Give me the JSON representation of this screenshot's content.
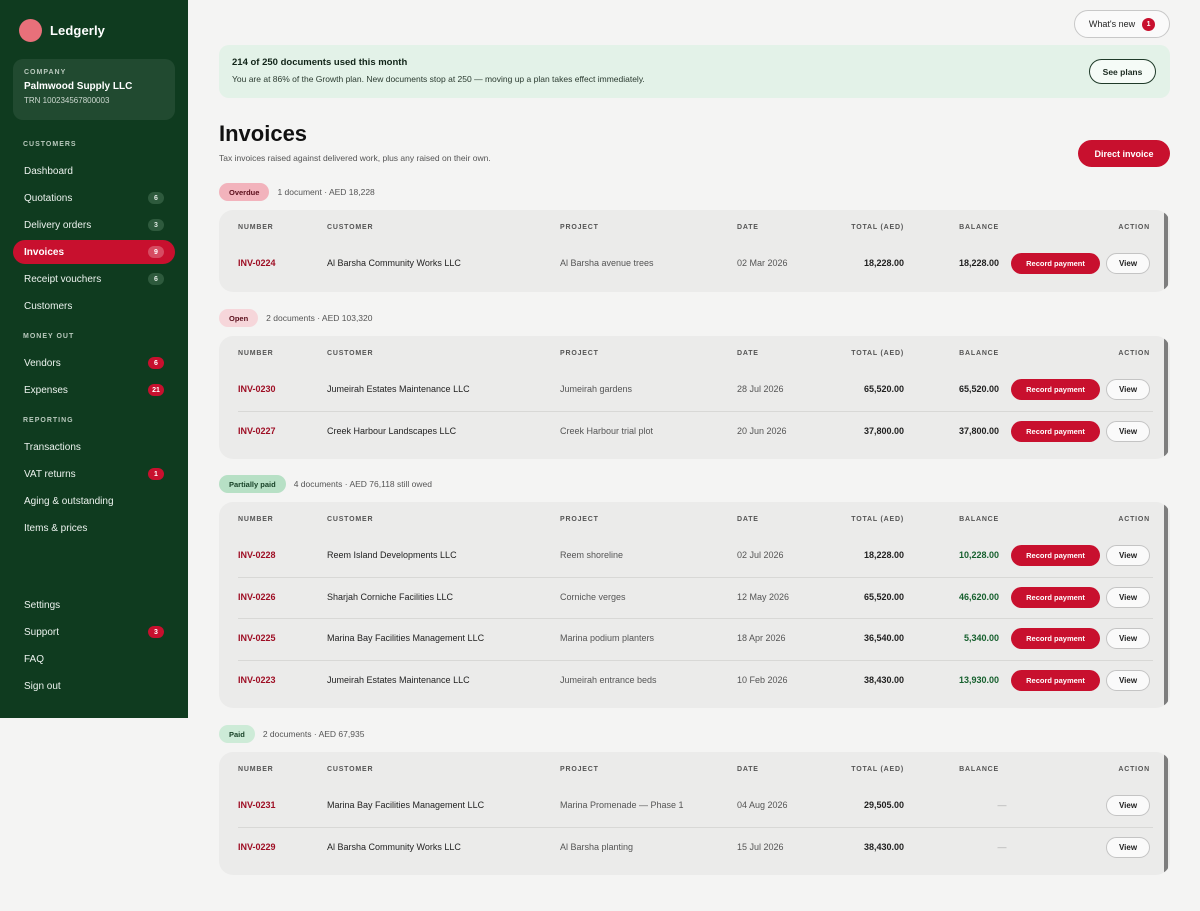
{
  "brand": {
    "name": "Ledgerly"
  },
  "company": {
    "label": "COMPANY",
    "name": "Palmwood Supply LLC",
    "trn": "TRN 100234567800003"
  },
  "sidebar": {
    "customers_label": "CUSTOMERS",
    "money_out_label": "MONEY OUT",
    "reporting_label": "REPORTING",
    "items": [
      {
        "label": "Dashboard",
        "count": ""
      },
      {
        "label": "Quotations",
        "count": "6"
      },
      {
        "label": "Delivery orders",
        "count": "3"
      },
      {
        "label": "Invoices",
        "count": "9"
      },
      {
        "label": "Receipt vouchers",
        "count": "6"
      },
      {
        "label": "Customers",
        "count": ""
      },
      {
        "label": "Vendors",
        "count": "6"
      },
      {
        "label": "Expenses",
        "count": "21"
      },
      {
        "label": "Transactions",
        "count": ""
      },
      {
        "label": "VAT returns",
        "count": "1"
      },
      {
        "label": "Aging & outstanding",
        "count": ""
      },
      {
        "label": "Items & prices",
        "count": ""
      },
      {
        "label": "Settings",
        "count": ""
      },
      {
        "label": "Support",
        "count": "3"
      },
      {
        "label": "FAQ",
        "count": ""
      },
      {
        "label": "Sign out",
        "count": ""
      }
    ]
  },
  "header": {
    "whats_new": "What's new",
    "whats_new_count": "1"
  },
  "plan": {
    "title": "214 of 250 documents used this month",
    "text": "You are at 86% of the Growth plan. New documents stop at 250 — moving up a plan takes effect immediately.",
    "button": "See plans"
  },
  "page": {
    "title": "Invoices",
    "subtitle": "Tax invoices raised against delivered work, plus any raised on their own.",
    "direct_button": "Direct invoice"
  },
  "columns": [
    "NUMBER",
    "CUSTOMER",
    "PROJECT",
    "DATE",
    "TOTAL (AED)",
    "BALANCE",
    "ACTION"
  ],
  "actions": {
    "record": "Record payment",
    "view": "View"
  },
  "groups": [
    {
      "status": "Overdue",
      "meta": "1 document · AED 18,228",
      "rows": [
        {
          "number": "INV-0224",
          "customer": "Al Barsha Community Works LLC",
          "project": "Al Barsha avenue trees",
          "date": "02 Mar 2026",
          "total": "18,228.00",
          "balance": "18,228.00"
        }
      ]
    },
    {
      "status": "Open",
      "meta": "2 documents · AED 103,320",
      "rows": [
        {
          "number": "INV-0230",
          "customer": "Jumeirah Estates Maintenance LLC",
          "project": "Jumeirah gardens",
          "date": "28 Jul 2026",
          "total": "65,520.00",
          "balance": "65,520.00"
        },
        {
          "number": "INV-0227",
          "customer": "Creek Harbour Landscapes LLC",
          "project": "Creek Harbour trial plot",
          "date": "20 Jun 2026",
          "total": "37,800.00",
          "balance": "37,800.00"
        }
      ]
    },
    {
      "status": "Partially paid",
      "meta": "4 documents · AED 76,118 still owed",
      "rows": [
        {
          "number": "INV-0228",
          "customer": "Reem Island Developments LLC",
          "project": "Reem shoreline",
          "date": "02 Jul 2026",
          "total": "18,228.00",
          "balance": "10,228.00"
        },
        {
          "number": "INV-0226",
          "customer": "Sharjah Corniche Facilities LLC",
          "project": "Corniche verges",
          "date": "12 May 2026",
          "total": "65,520.00",
          "balance": "46,620.00"
        },
        {
          "number": "INV-0225",
          "customer": "Marina Bay Facilities Management LLC",
          "project": "Marina podium planters",
          "date": "18 Apr 2026",
          "total": "36,540.00",
          "balance": "5,340.00"
        },
        {
          "number": "INV-0223",
          "customer": "Jumeirah Estates Maintenance LLC",
          "project": "Jumeirah entrance beds",
          "date": "10 Feb 2026",
          "total": "38,430.00",
          "balance": "13,930.00"
        }
      ]
    },
    {
      "status": "Paid",
      "meta": "2 documents · AED 67,935",
      "rows": [
        {
          "number": "INV-0231",
          "customer": "Marina Bay Facilities Management LLC",
          "project": "Marina Promenade — Phase 1",
          "date": "04 Aug 2026",
          "total": "29,505.00",
          "balance": "—"
        },
        {
          "number": "INV-0229",
          "customer": "Al Barsha Community Works LLC",
          "project": "Al Barsha planting",
          "date": "15 Jul 2026",
          "total": "38,430.00",
          "balance": "—"
        }
      ]
    }
  ]
}
